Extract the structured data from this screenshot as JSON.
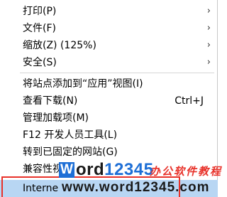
{
  "menu": {
    "items": [
      {
        "label": "打印(P)",
        "submenu": true
      },
      {
        "label": "文件(F)",
        "submenu": true
      },
      {
        "label": "缩放(Z) (125%)",
        "submenu": true
      },
      {
        "label": "安全(S)",
        "submenu": true
      },
      {
        "label": "将站点添加到“应用”视图(I)"
      },
      {
        "label": "查看下载(N)",
        "shortcut": "Ctrl+J"
      },
      {
        "label": "管理加载项(M)"
      },
      {
        "label": "F12 开发人员工具(L)"
      },
      {
        "label": "转到已固定的网站(G)"
      },
      {
        "label": "兼容性视"
      },
      {
        "label": "Interne"
      }
    ],
    "arrow_glyph": "›"
  },
  "watermark": {
    "logo_letter": "W",
    "word": "ord",
    "number": "12345",
    "cn_text": "办公软件教程",
    "url": "www.word12345.com"
  },
  "colors": {
    "highlight": "#b8d6f3",
    "red_box": "#e8322a",
    "watermark_blue": "#1e6fd6"
  }
}
